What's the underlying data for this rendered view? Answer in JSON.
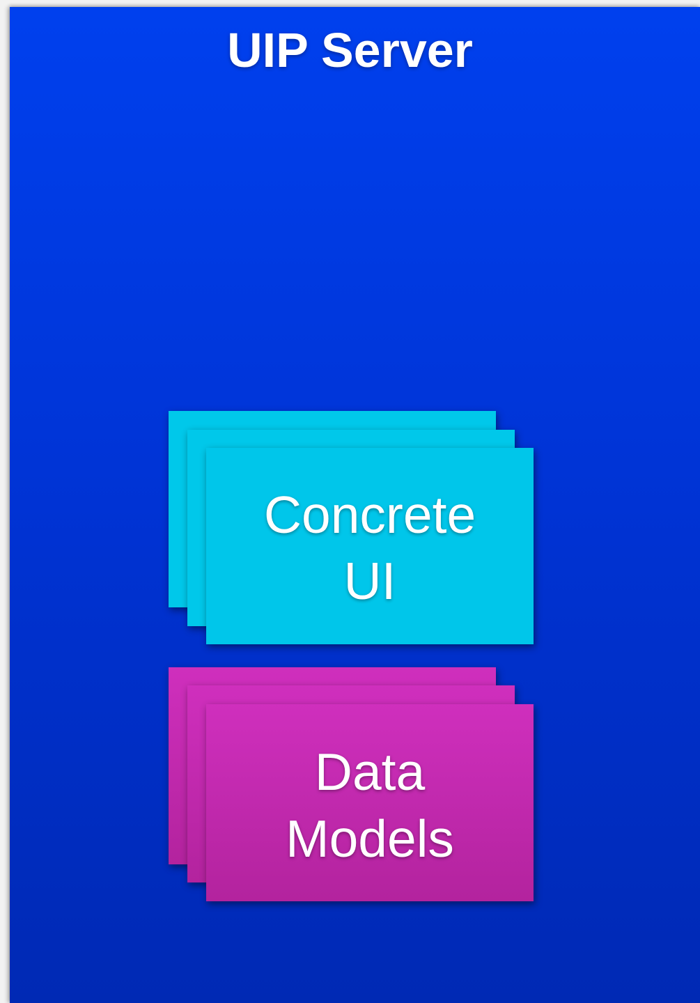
{
  "server": {
    "title": "UIP Server",
    "color": "#0033d4"
  },
  "concrete_ui": {
    "line1": "Concrete",
    "line2": "UI",
    "color": "#00c6ea",
    "stack_count": 3
  },
  "data_models": {
    "line1": "Data",
    "line2": "Models",
    "color": "#c42ab0",
    "stack_count": 3
  }
}
